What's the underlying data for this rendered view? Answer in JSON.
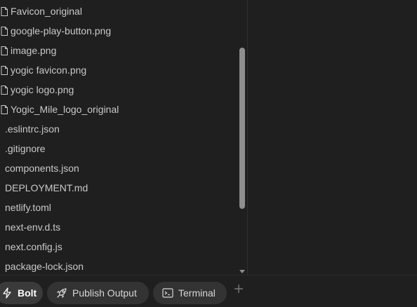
{
  "file_tree": {
    "items": [
      {
        "name": "Favicon_original",
        "has_icon": true
      },
      {
        "name": "google-play-button.png",
        "has_icon": true
      },
      {
        "name": "image.png",
        "has_icon": true
      },
      {
        "name": "yogic favicon.png",
        "has_icon": true
      },
      {
        "name": "yogic logo.png",
        "has_icon": true
      },
      {
        "name": "Yogic_Mile_logo_original",
        "has_icon": true
      },
      {
        "name": ".eslintrc.json",
        "has_icon": false
      },
      {
        "name": ".gitignore",
        "has_icon": false
      },
      {
        "name": "components.json",
        "has_icon": false
      },
      {
        "name": "DEPLOYMENT.md",
        "has_icon": false
      },
      {
        "name": "netlify.toml",
        "has_icon": false
      },
      {
        "name": "next-env.d.ts",
        "has_icon": false
      },
      {
        "name": "next.config.js",
        "has_icon": false
      },
      {
        "name": "package-lock.json",
        "has_icon": false
      }
    ],
    "icon": "file-icon"
  },
  "bottom_tabs": {
    "bolt": {
      "label": "Bolt",
      "icon": "lightning-icon",
      "active": true
    },
    "publish": {
      "label": "Publish Output",
      "icon": "rocket-icon",
      "active": false
    },
    "terminal": {
      "label": "Terminal",
      "icon": "terminal-icon",
      "active": false
    },
    "add_icon": "plus-icon"
  },
  "colors": {
    "background": "#1f1f1f",
    "tab_bg": "#333333",
    "text": "#c9c9c9",
    "scroll_thumb": "#8e8e8e"
  }
}
